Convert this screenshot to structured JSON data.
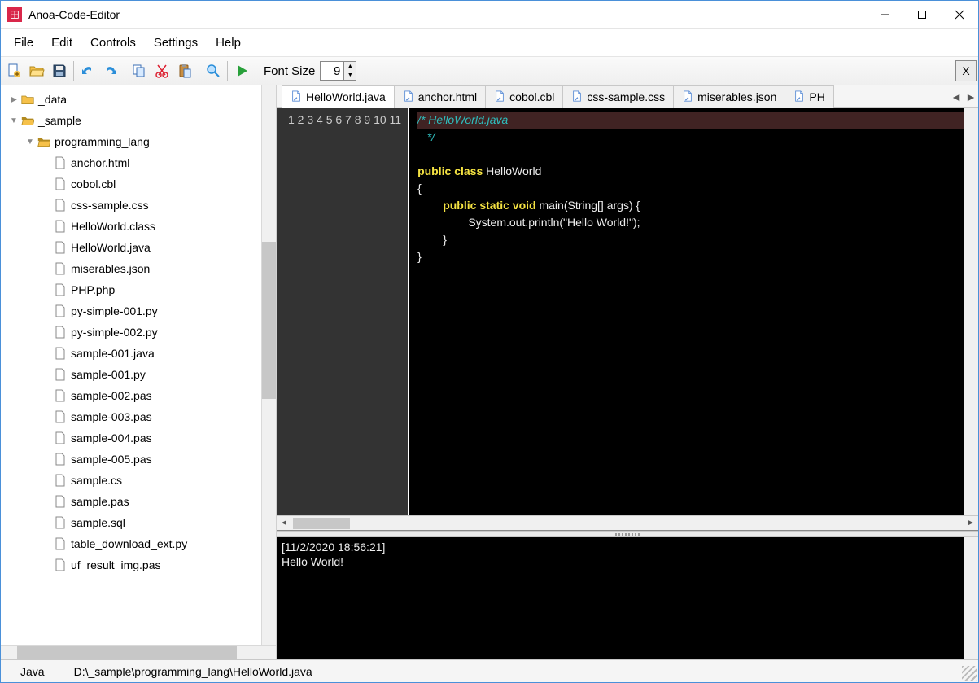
{
  "window": {
    "title": "Anoa-Code-Editor"
  },
  "menus": {
    "file": "File",
    "edit": "Edit",
    "controls": "Controls",
    "settings": "Settings",
    "help": "Help"
  },
  "toolbar": {
    "font_label": "Font Size",
    "font_value": "9",
    "close_all": "X"
  },
  "tree": {
    "root1": "_data",
    "root2": "_sample",
    "sub1": "programming_lang",
    "files": [
      "anchor.html",
      "cobol.cbl",
      "css-sample.css",
      "HelloWorld.class",
      "HelloWorld.java",
      "miserables.json",
      "PHP.php",
      "py-simple-001.py",
      "py-simple-002.py",
      "sample-001.java",
      "sample-001.py",
      "sample-002.pas",
      "sample-003.pas",
      "sample-004.pas",
      "sample-005.pas",
      "sample.cs",
      "sample.pas",
      "sample.sql",
      "table_download_ext.py",
      "uf_result_img.pas"
    ]
  },
  "tabs": {
    "items": [
      "HelloWorld.java",
      "anchor.html",
      "cobol.cbl",
      "css-sample.css",
      "miserables.json",
      "PH"
    ],
    "activeIndex": 0
  },
  "editor": {
    "lineCount": 11,
    "lines": {
      "l1a": "/* HelloWorld.java",
      "l2a": " */",
      "l4_key1": "public",
      "l4_key2": "class",
      "l4_rest": " HelloWorld",
      "l5": "{",
      "l6_key1": "public",
      "l6_key2": "static",
      "l6_key3": "void",
      "l6_rest": " main(String[] args) {",
      "l7": "                System.out.println(\"Hello World!\");",
      "l8": "        }",
      "l9": "}"
    }
  },
  "console": {
    "line1": "[11/2/2020 18:56:21]",
    "line2": "Hello World!"
  },
  "status": {
    "lang": "Java",
    "path": "D:\\_sample\\programming_lang\\HelloWorld.java"
  }
}
